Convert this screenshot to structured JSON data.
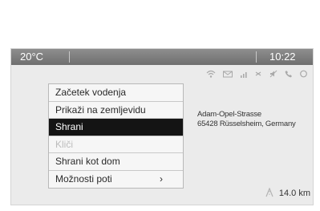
{
  "status_bar": {
    "temperature": "20°C",
    "time": "10:22"
  },
  "status_icons": [
    "wifi-icon",
    "message-icon",
    "signal-icon",
    "bluetooth-off-icon",
    "mute-icon",
    "phone-icon",
    "disc-icon"
  ],
  "menu": {
    "items": [
      {
        "label": "Začetek vodenja"
      },
      {
        "label": "Prikaži na zemljevidu"
      },
      {
        "label": "Shrani",
        "selected": true
      },
      {
        "label": "Kliči",
        "disabled": true
      },
      {
        "label": "Shrani kot dom"
      },
      {
        "label": "Možnosti poti",
        "arrow": "›"
      }
    ]
  },
  "address": {
    "line1": "Adam-Opel-Strasse",
    "line2": "65428 Rüsselsheim, Germany"
  },
  "route": {
    "icon": "distance-icon",
    "distance": "14.0 km"
  },
  "colors": {
    "status_bar": "#7a7a7a",
    "selected_item": "#141414",
    "background": "#ebebeb"
  }
}
